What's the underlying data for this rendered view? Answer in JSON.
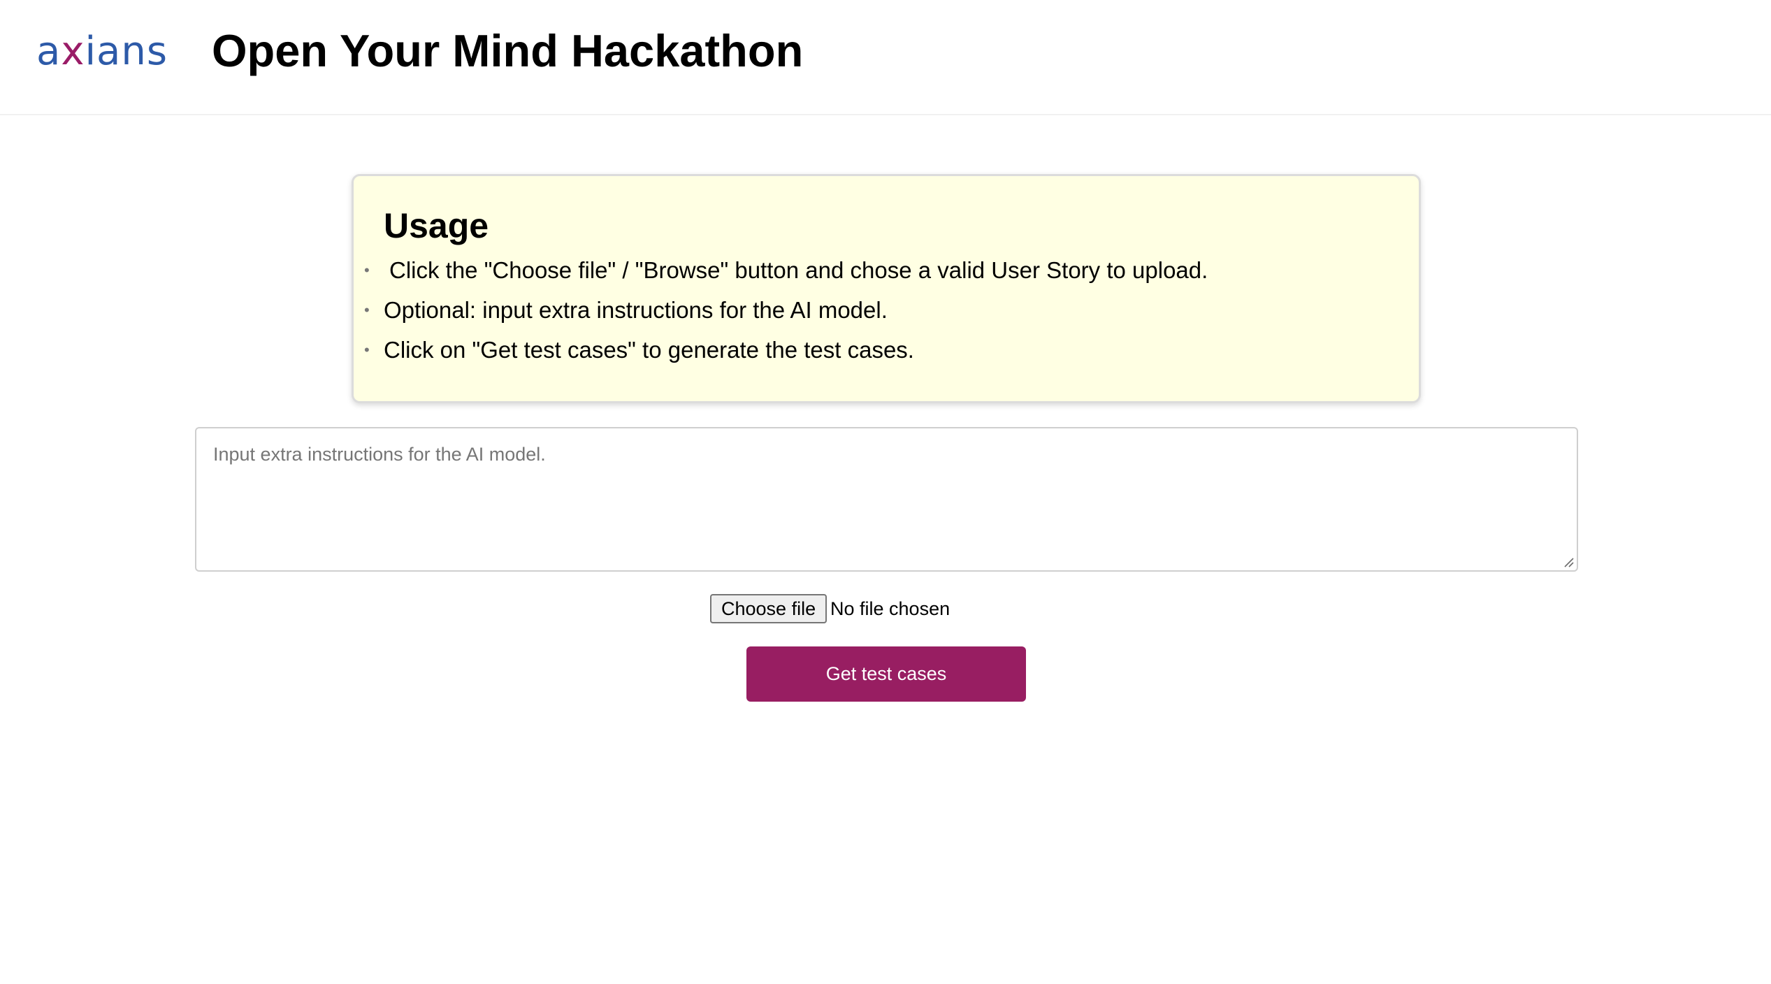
{
  "header": {
    "logo_text": "axians",
    "title": "Open Your Mind Hackathon"
  },
  "usage": {
    "title": "Usage",
    "items": [
      "Click the \"Choose file\" / \"Browse\" button and chose a valid User Story to upload.",
      "Optional: input extra instructions for the AI model.",
      "Click on \"Get test cases\" to generate the test cases."
    ]
  },
  "instructions": {
    "placeholder": "Input extra instructions for the AI model.",
    "value": ""
  },
  "file_input": {
    "button_label": "Choose file",
    "status": "No file chosen"
  },
  "submit": {
    "label": "Get test cases"
  },
  "colors": {
    "brand_blue": "#2d5aa8",
    "brand_magenta": "#9a1c67",
    "button_bg": "#981e62",
    "usage_bg": "#ffffe3"
  }
}
